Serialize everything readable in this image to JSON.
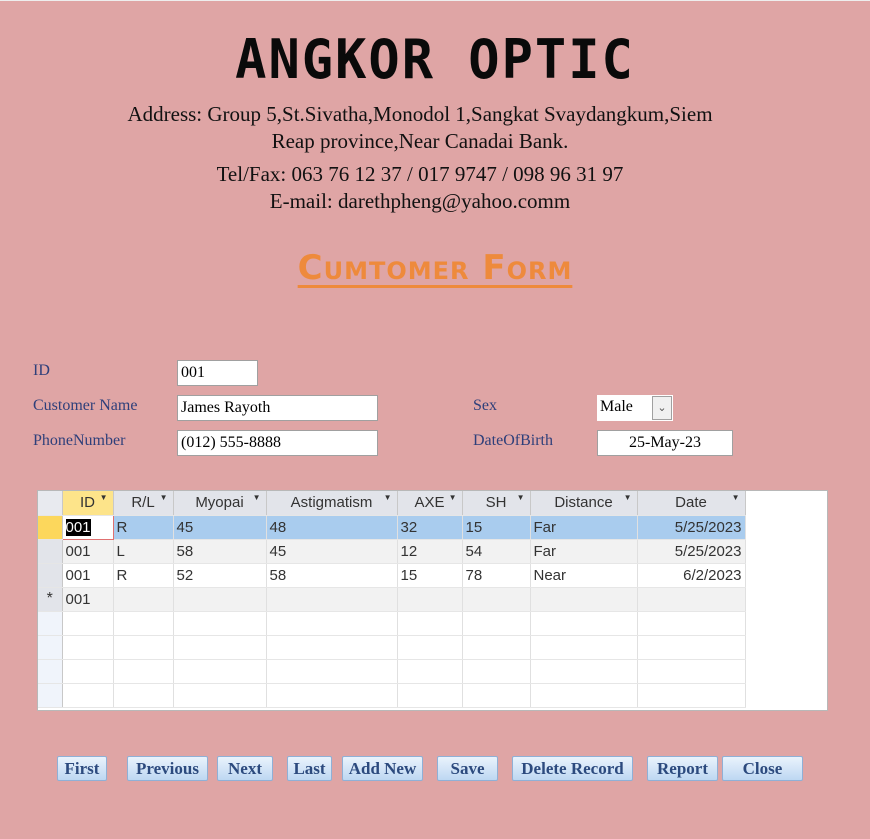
{
  "header": {
    "title": "ANGKOR OPTIC",
    "address_line1": "Address: Group 5,St.Sivatha,Monodol 1,Sangkat Svaydangkum,Siem",
    "address_line2": "Reap province,Near Canadai Bank.",
    "tel": "Tel/Fax: 063 76 12 37 / 017 9747 / 098 96 31 97",
    "email": "E-mail: darethpheng@yahoo.comm",
    "form_title": "Cumtomer Form"
  },
  "form": {
    "id_label": "ID",
    "id_value": "001",
    "name_label": "Customer Name",
    "name_value": "James Rayoth",
    "phone_label": "PhoneNumber",
    "phone_value": "(012) 555-8888",
    "sex_label": "Sex",
    "sex_value": "Male",
    "dob_label": "DateOfBirth",
    "dob_value": "25-May-23"
  },
  "grid": {
    "columns": [
      "ID",
      "R/L",
      "Myopai",
      "Astigmatism",
      "AXE",
      "SH",
      "Distance",
      "Date"
    ],
    "rows": [
      [
        "001",
        "R",
        "45",
        "48",
        "32",
        "15",
        "Far",
        "5/25/2023"
      ],
      [
        "001",
        "L",
        "58",
        "45",
        "12",
        "54",
        "Far",
        "5/25/2023"
      ],
      [
        "001",
        "R",
        "52",
        "58",
        "15",
        "78",
        "Near",
        "6/2/2023"
      ]
    ],
    "new_row_marker": "*",
    "new_row_id": "001"
  },
  "buttons": [
    "First",
    "Previous",
    "Next",
    "Last",
    "Add New",
    "Save",
    "Delete Record",
    "Report",
    "Close"
  ],
  "colors": {
    "background": "#dfa5a5",
    "form_title": "#ee8a3c",
    "label": "#2e3f7a",
    "button_text": "#2c4a7e",
    "selected_row": "#a9ccee"
  }
}
